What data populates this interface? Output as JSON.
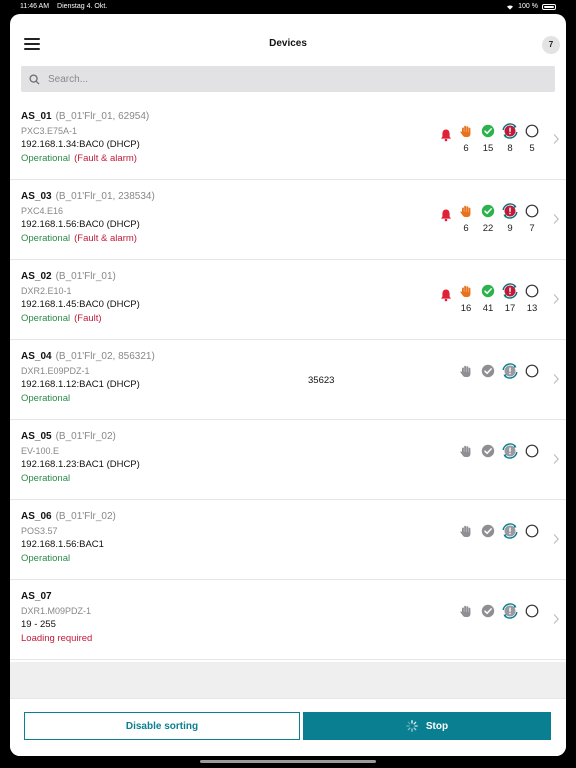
{
  "statusbar": {
    "time": "11:46 AM",
    "date": "Dienstag 4. Okt.",
    "battery": "100 %"
  },
  "header": {
    "title": "Devices",
    "count": "7"
  },
  "search": {
    "placeholder": "Search..."
  },
  "devices": [
    {
      "name": "AS_01",
      "location": "(B_01'Flr_01, 62954)",
      "model": "PXC3.E75A-1",
      "address": "192.168.1.34:BAC0 (DHCP)",
      "status": "Operational",
      "status_extra": "(Fault & alarm)",
      "middle": "",
      "alarm": true,
      "active": true,
      "counts": [
        "6",
        "15",
        "8",
        "5"
      ]
    },
    {
      "name": "AS_03",
      "location": "(B_01'Flr_01, 238534)",
      "model": "PXC4.E16",
      "address": "192.168.1.56:BAC0 (DHCP)",
      "status": "Operational",
      "status_extra": "(Fault & alarm)",
      "middle": "",
      "alarm": true,
      "active": true,
      "counts": [
        "6",
        "22",
        "9",
        "7"
      ]
    },
    {
      "name": "AS_02",
      "location": "(B_01'Flr_01)",
      "model": "DXR2.E10-1",
      "address": "192.168.1.45:BAC0 (DHCP)",
      "status": "Operational",
      "status_extra": "(Fault)",
      "middle": "",
      "alarm": true,
      "active": true,
      "counts": [
        "16",
        "41",
        "17",
        "13"
      ]
    },
    {
      "name": "AS_04",
      "location": "(B_01'Flr_02, 856321)",
      "model": "DXR1.E09PDZ-1",
      "address": "192.168.1.12:BAC1 (DHCP)",
      "status": "Operational",
      "status_extra": "",
      "middle": "35623",
      "alarm": false,
      "active": false,
      "counts": [
        "",
        "",
        "",
        ""
      ]
    },
    {
      "name": "AS_05",
      "location": "(B_01'Flr_02)",
      "model": "EV-100.E",
      "address": "192.168.1.23:BAC1 (DHCP)",
      "status": "Operational",
      "status_extra": "",
      "middle": "",
      "alarm": false,
      "active": false,
      "counts": [
        "",
        "",
        "",
        ""
      ]
    },
    {
      "name": "AS_06",
      "location": "(B_01'Flr_02)",
      "model": "POS3.57",
      "address": "192.168.1.56:BAC1",
      "status": "Operational",
      "status_extra": "",
      "middle": "",
      "alarm": false,
      "active": false,
      "counts": [
        "",
        "",
        "",
        ""
      ]
    },
    {
      "name": "AS_07",
      "location": "",
      "model": "DXR1.M09PDZ-1",
      "address": "19 - 255",
      "status": "Loading required",
      "status_extra": "",
      "middle": "",
      "alarm": false,
      "active": false,
      "counts": [
        "",
        "",
        "",
        ""
      ]
    }
  ],
  "icons": {
    "alarm": "bell-icon",
    "manual": "hand-icon",
    "ok": "check-circle-icon",
    "fault": "fault-sync-icon",
    "empty": "empty-circle-icon",
    "chevron": "chevron-right-icon"
  },
  "colors": {
    "accent": "#0a7f91",
    "alarm": "#e0203a",
    "manual": "#e8731c",
    "ok": "#2bb24c",
    "fault": "#c01a3a",
    "operational": "#2a8a4a"
  },
  "footer": {
    "sort_label": "Disable sorting",
    "stop_label": "Stop"
  }
}
